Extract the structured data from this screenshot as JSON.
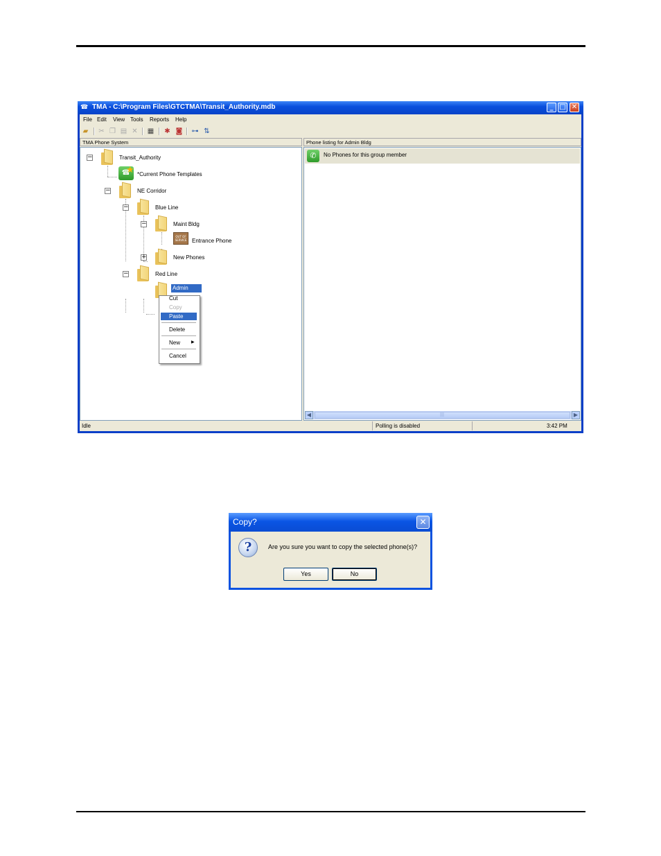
{
  "window": {
    "title": "TMA - C:\\Program Files\\GTCTMA\\Transit_Authority.mdb",
    "app_icon": "tma-app-icon"
  },
  "menu": [
    "File",
    "Edit",
    "View",
    "Tools",
    "Reports",
    "Help"
  ],
  "toolbar_icons": [
    "open-icon",
    "cut-icon",
    "copy-icon",
    "paste-icon",
    "delete-icon",
    "properties-icon",
    "poll-icon",
    "alarm-icon",
    "tree-expand-icon",
    "sort-icon"
  ],
  "left_pane": {
    "header": "TMA Phone System",
    "tree": {
      "root": "Transit_Authority",
      "templates": "*Current Phone Templates",
      "corridor": "NE Corridor",
      "blue_line": "Blue Line",
      "maint_bldg": "Maint Bldg",
      "entrance_phone": "Entrance Phone",
      "out_of_service_tag": "OUT OF SERVICE",
      "new_phones": "New Phones",
      "red_line": "Red Line",
      "admin_bldg": "Admin Bldg"
    }
  },
  "context_menu": {
    "cut": "Cut",
    "copy": "Copy",
    "paste": "Paste",
    "delete": "Delete",
    "new": "New",
    "cancel": "Cancel"
  },
  "right_pane": {
    "header": "Phone listing for Admin Bldg",
    "empty_message": "No Phones for this group member"
  },
  "status_bar": {
    "state": "Idle",
    "polling": "Polling is disabled",
    "time": "3:42 PM"
  },
  "dialog": {
    "title": "Copy?",
    "message": "Are you sure you want to copy the selected phone(s)?",
    "yes": "Yes",
    "no": "No"
  },
  "colors": {
    "titlebar": "#0a4fdd",
    "selection": "#316ac5",
    "window_face": "#ece9d8"
  }
}
